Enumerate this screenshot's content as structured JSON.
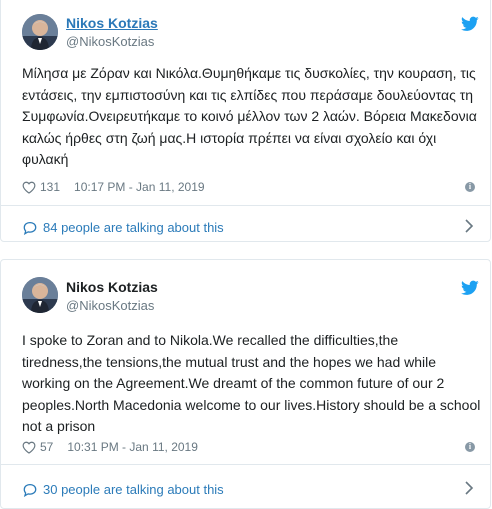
{
  "tweets": [
    {
      "name": "Nikos Kotzias",
      "handle": "@NikosKotzias",
      "text": "Μίλησα με Ζόραν και Νικόλα.Θυμηθήκαμε τις δυσκολίες, την κουραση, τις εντάσεις, την εμπιστοσύνη και τις ελπίδες που περάσαμε δουλεύοντας τη Συμφωνία.Ονειρευτήκαμε το κοινό μέλλον των 2 λαών. Βόρεια Μακεδονια καλώς ήρθες στη ζωή μας.Η ιστορία πρέπει να είναι σχολείο και όχι φυλακή",
      "likes": "131",
      "time": "10:17 PM - Jan 11, 2019",
      "talking": "84 people are talking about this"
    },
    {
      "name": "Nikos Kotzias",
      "handle": "@NikosKotzias",
      "text": "I spoke to Zoran and to Nikola.We recalled the difficulties,the tiredness,the tensions,the mutual trust and the hopes we had while working on the Agreement.We dreamt of the common future of our 2 peoples.North Macedonia welcome to our lives.History should be a school not a prison",
      "likes": "57",
      "time": "10:31 PM - Jan 11, 2019",
      "talking": "30 people are talking about this"
    }
  ],
  "icons": {
    "brand": "twitter-bird-icon",
    "like": "heart-icon",
    "info": "info-icon",
    "talk": "speech-bubble-icon",
    "more": "chevron-right-icon"
  },
  "colors": {
    "link": "#2b7bb9",
    "bird": "#1da1f2",
    "muted": "#697882",
    "border": "#e1e8ed"
  }
}
